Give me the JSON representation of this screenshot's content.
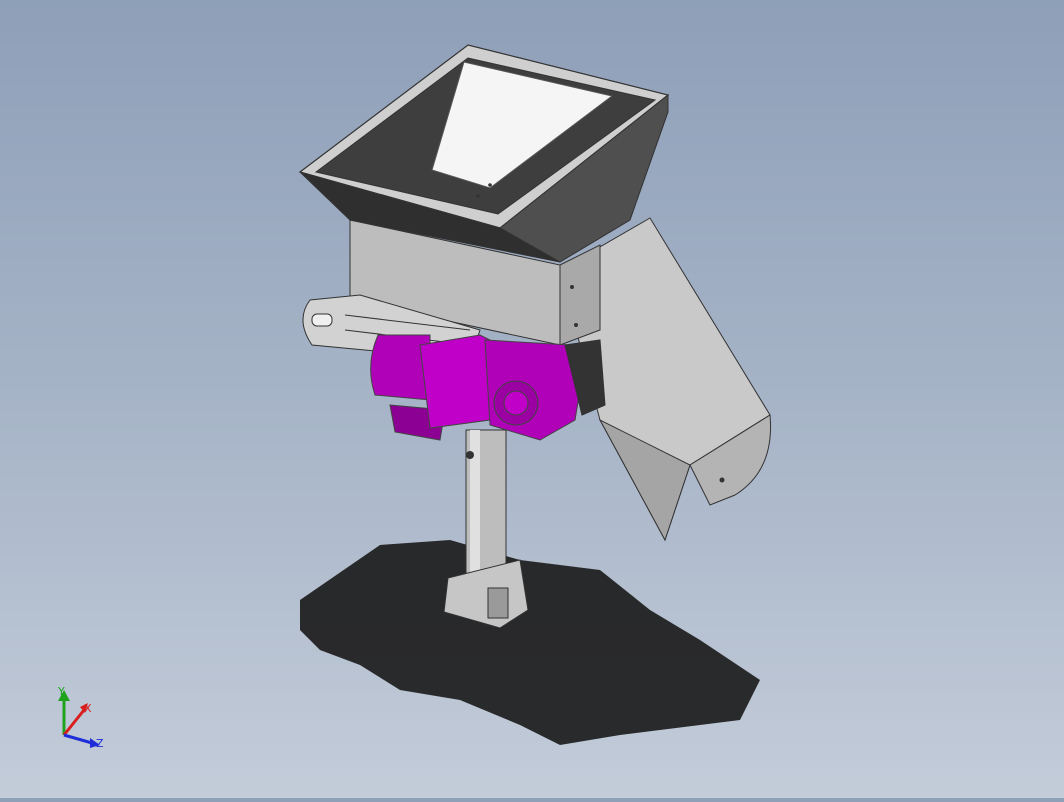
{
  "viewport": {
    "background_top": "#8e9fb8",
    "background_bottom": "#c3ccd9"
  },
  "model": {
    "body_color": "#c8c8c8",
    "body_dark": "#4a4a4a",
    "motor_color": "#b000b8",
    "motor_dark": "#7a0083",
    "shadow_color": "#1c1c1c"
  },
  "triad": {
    "x_label": "X",
    "y_label": "Y",
    "z_label": "Z",
    "x_color": "#d81e1e",
    "y_color": "#1fa31f",
    "z_color": "#1e2ed8"
  }
}
